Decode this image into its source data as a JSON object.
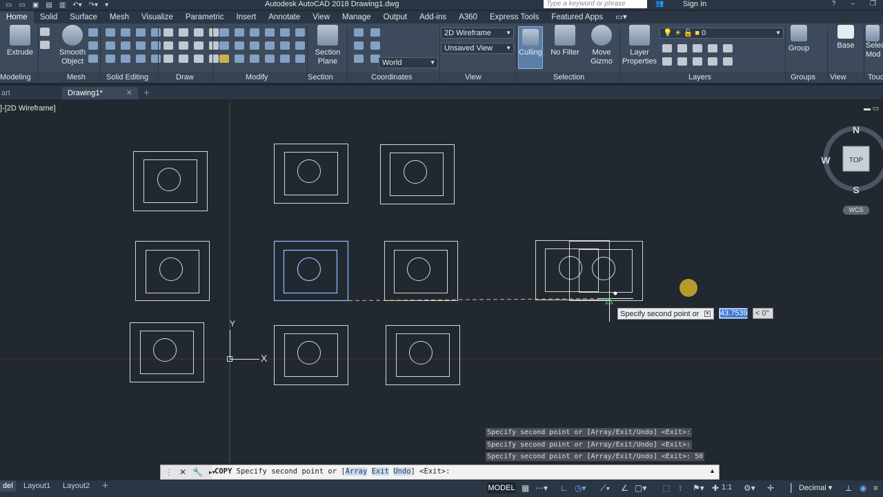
{
  "window": {
    "title": "Autodesk AutoCAD 2018    Drawing1.dwg",
    "search_placeholder": "Type a keyword or phrase",
    "sign_in": "Sign In"
  },
  "ribbon_tabs": [
    "Home",
    "Solid",
    "Surface",
    "Mesh",
    "Visualize",
    "Parametric",
    "Insert",
    "Annotate",
    "View",
    "Manage",
    "Output",
    "Add-ins",
    "A360",
    "Express Tools",
    "Featured Apps"
  ],
  "ribbon": {
    "extrude": "Extrude",
    "smooth_object": "Smooth\nObject",
    "section_plane": "Section\nPlane",
    "culling": "Culling",
    "no_filter": "No Filter",
    "move_gizmo": "Move\nGizmo",
    "layer_properties": "Layer\nProperties",
    "group": "Group",
    "base": "Base",
    "select_mode": "Selec\nMod",
    "visual_style": "2D Wireframe",
    "view_name": "Unsaved View",
    "ucs": "World",
    "layer_current": "0"
  },
  "panels": [
    "Modeling",
    "Mesh",
    "Solid Editing",
    "Draw",
    "Modify",
    "Section",
    "Coordinates",
    "View",
    "Selection",
    "Layers",
    "Groups",
    "View",
    "Touc"
  ],
  "file_tabs": {
    "start": "art",
    "drawing": "Drawing1*"
  },
  "viewport_label": "]-[2D Wireframe]",
  "viewcube": {
    "north": "N",
    "south": "S",
    "west": "W",
    "face": "TOP",
    "wcs": "WCS"
  },
  "ucs_icon": {
    "x": "X",
    "y": "Y"
  },
  "dynamic_input": {
    "prompt": "Specify second point or",
    "distance": "43.7539",
    "angle": "< 0°"
  },
  "command_history": [
    "Specify second point or [Array/Exit/Undo] <Exit>:",
    "Specify second point or [Array/Exit/Undo] <Exit>:",
    "Specify second point or [Array/Exit/Undo] <Exit>: 50"
  ],
  "command_line": {
    "command": "COPY",
    "prompt_start": "Specify second point or [",
    "opt_array": "Array",
    "opt_exit": "Exit",
    "opt_undo": "Undo",
    "prompt_end": "] <Exit>:"
  },
  "layout_tabs": [
    "del",
    "Layout1",
    "Layout2"
  ],
  "status": {
    "model": "MODEL",
    "scale": "1:1",
    "units": "Decimal"
  },
  "colors": {
    "canvas": "#212830",
    "ribbon": "#3c4a5b",
    "selected": "#6fa3e8",
    "tracking": "#e0c44a"
  }
}
